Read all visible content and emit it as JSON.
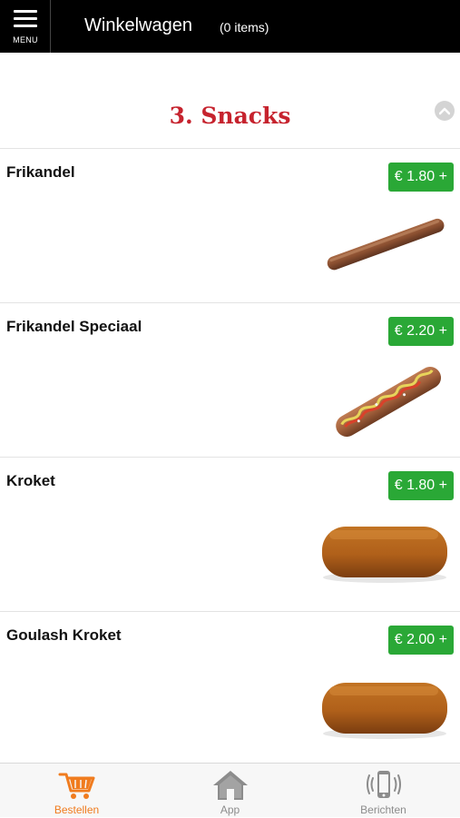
{
  "header": {
    "menu_label": "MENU",
    "title": "Winkelwagen",
    "count": "(0 items)"
  },
  "section": {
    "title": "3. Snacks"
  },
  "items": [
    {
      "name": "Frikandel",
      "price": "€ 1.80 +",
      "image": "frikandel"
    },
    {
      "name": "Frikandel Speciaal",
      "price": "€ 2.20 +",
      "image": "frikandel-speciaal"
    },
    {
      "name": "Kroket",
      "price": "€ 1.80 +",
      "image": "kroket"
    },
    {
      "name": "Goulash Kroket",
      "price": "€ 2.00 +",
      "image": "kroket"
    }
  ],
  "bottom_nav": [
    {
      "label": "Bestellen",
      "icon": "cart-icon",
      "active": true
    },
    {
      "label": "App",
      "icon": "home-icon",
      "active": false
    },
    {
      "label": "Berichten",
      "icon": "phone-vibrate-icon",
      "active": false
    }
  ],
  "colors": {
    "header_bg": "#000000",
    "section_title": "#c6232e",
    "price_bg": "#2aa836",
    "nav_active": "#f07c1f",
    "nav_inactive": "#8c8c8c"
  }
}
